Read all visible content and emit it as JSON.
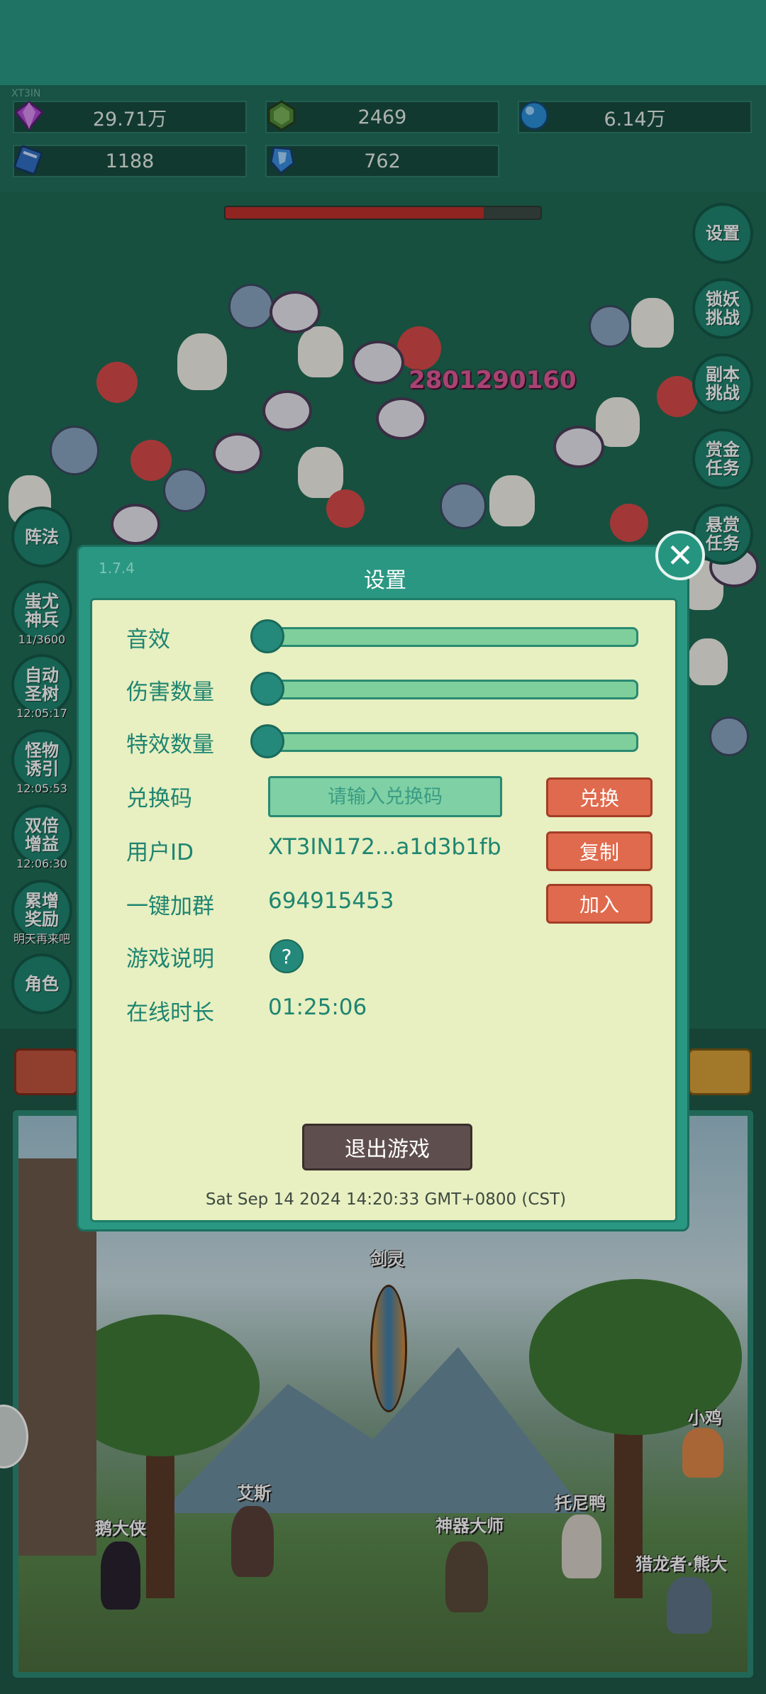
{
  "top": {
    "tiny_label": "XT3IN"
  },
  "resources": [
    {
      "icon": "purple-gem-icon",
      "value": "29.71万"
    },
    {
      "icon": "green-gem-icon",
      "value": "2469"
    },
    {
      "icon": "blue-orb-icon",
      "value": "6.14万"
    },
    {
      "icon": "blue-book-icon",
      "value": "1188"
    },
    {
      "icon": "blue-crystal-icon",
      "value": "762"
    }
  ],
  "boss_hp_fraction": 0.82,
  "damage_number": "2801290160",
  "right_buttons": [
    "设置",
    "锁妖挑战",
    "副本挑战",
    "赏金任务",
    "悬赏任务"
  ],
  "left_buttons": [
    {
      "label": "阵法",
      "sub": ""
    },
    {
      "label": "蚩尤神兵",
      "sub": "11/3600"
    },
    {
      "label": "自动圣树",
      "sub": "12:05:17"
    },
    {
      "label": "怪物诱引",
      "sub": "12:05:53"
    },
    {
      "label": "双倍增益",
      "sub": "12:06:30"
    },
    {
      "label": "累增奖励",
      "sub": "明天再来吧"
    },
    {
      "label": "角色",
      "sub": ""
    }
  ],
  "scene": {
    "weapon_name": "剑灵",
    "characters": [
      "小鸡",
      "艾斯",
      "鹅大侠",
      "托尼鸭",
      "神器大师",
      "猎龙者·熊大"
    ]
  },
  "modal": {
    "version": "1.7.4",
    "title": "设置",
    "close_icon": "close-icon",
    "sound_label": "音效",
    "sound_level": 0,
    "damage_count_label": "伤害数量",
    "damage_count_level": 0,
    "effects_count_label": "特效数量",
    "effects_count_level": 0,
    "redeem_label": "兑换码",
    "redeem_placeholder": "请输入兑换码",
    "redeem_button": "兑换",
    "userid_label": "用户ID",
    "userid_value": "XT3IN172...a1d3b1fb",
    "copy_button": "复制",
    "group_label": "一键加群",
    "group_value": "694915453",
    "join_button": "加入",
    "guide_label": "游戏说明",
    "guide_icon": "?",
    "online_label": "在线时长",
    "online_value": "01:25:06",
    "exit_button": "退出游戏",
    "timestamp": "Sat Sep 14 2024 14:20:33 GMT+0800 (CST)"
  }
}
